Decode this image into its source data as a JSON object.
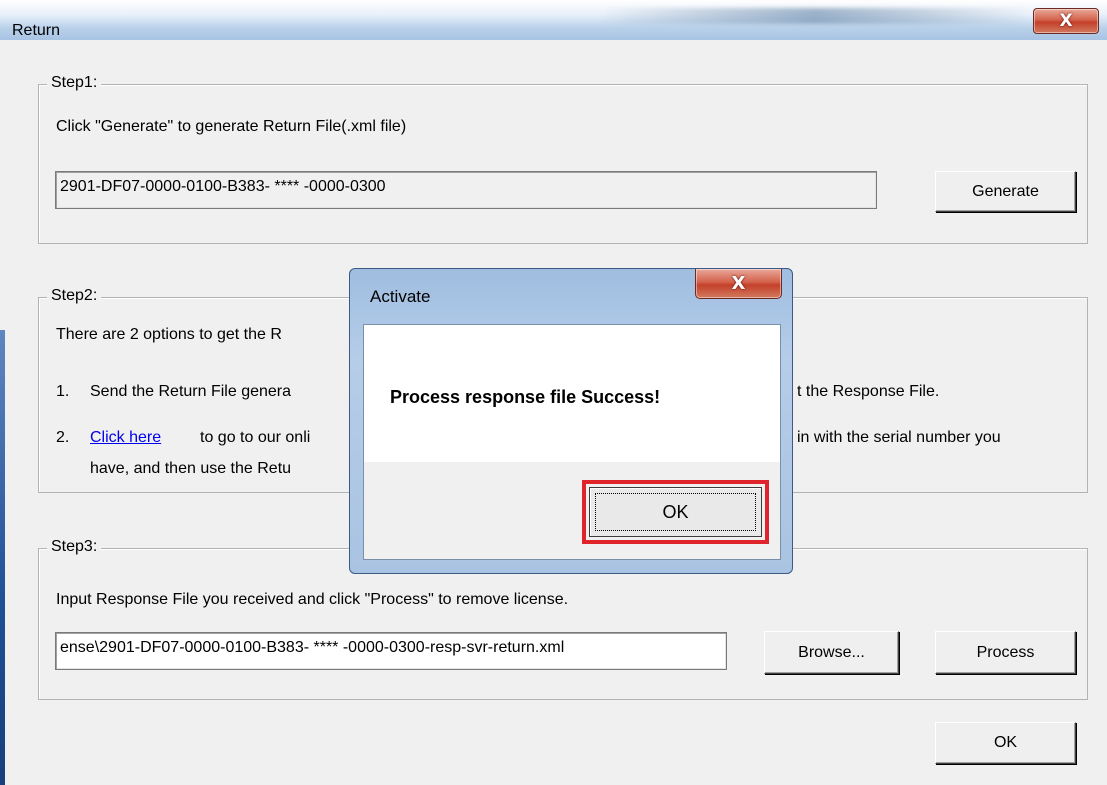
{
  "window": {
    "title": "Return",
    "close_glyph": "X",
    "close_icon": "close-icon",
    "ok_label": "OK"
  },
  "step1": {
    "legend": "Step1:",
    "instruction": "Click \"Generate\" to generate Return File(.xml file)",
    "serial_value": "2901-DF07-0000-0100-B383-  **** -0000-0300",
    "generate_label": "Generate"
  },
  "step2": {
    "legend": "Step2:",
    "intro": "There are 2 options to get the R",
    "option1_number": "1.",
    "option1_text_start": "Send the Return File genera",
    "option1_text_end": "t the Response File.",
    "option2_number": "2.",
    "option2_link": "Click here",
    "option2_text_start": "to go to our onli",
    "option2_text_end": "in with the serial number you",
    "option2_line2": "have, and then use the Retu"
  },
  "step3": {
    "legend": "Step3:",
    "instruction": "Input Response File you received and click \"Process\" to remove license.",
    "file_value": "ense\\2901-DF07-0000-0100-B383-  ****  -0000-0300-resp-svr-return.xml",
    "browse_label": "Browse...",
    "process_label": "Process"
  },
  "dialog": {
    "title": "Activate",
    "close_glyph": "X",
    "message": "Process response file Success!",
    "ok_label": "OK",
    "highlight_color": "#e0242b"
  }
}
